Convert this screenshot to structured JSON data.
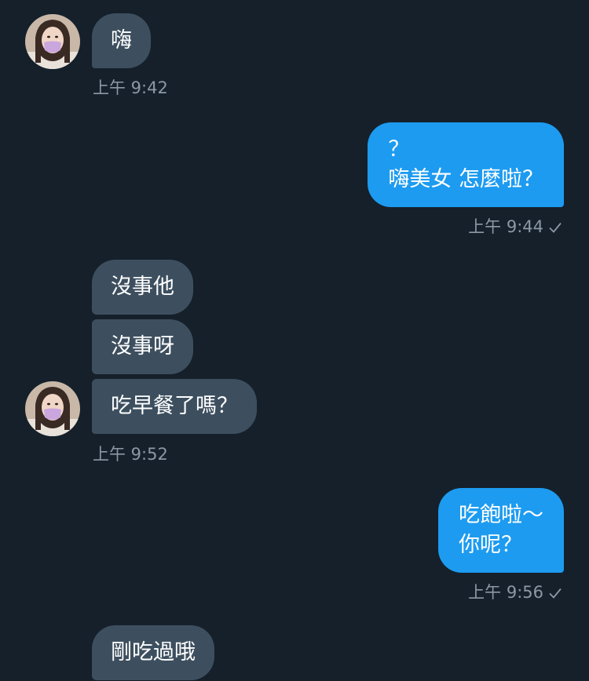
{
  "conversation": {
    "messages": [
      {
        "from": "them",
        "text": "嗨",
        "time": "上午 9:42"
      },
      {
        "from": "me",
        "lines": [
          "？",
          "嗨美女 怎麼啦？"
        ],
        "time": "上午 9:44"
      },
      {
        "from": "them",
        "text": "沒事他"
      },
      {
        "from": "them",
        "text": "沒事呀"
      },
      {
        "from": "them",
        "text": "吃早餐了嗎？",
        "time": "上午 9:52"
      },
      {
        "from": "me",
        "lines": [
          "吃飽啦～",
          "你呢？"
        ],
        "time": "上午 9:56"
      },
      {
        "from": "them",
        "text": "剛吃過哦"
      }
    ]
  },
  "icons": {
    "sent": "checkmark-icon",
    "avatar": "contact-avatar"
  },
  "colors": {
    "background": "#15202b",
    "incoming_bubble": "#3d4f5f",
    "outgoing_bubble": "#1d9bf0",
    "timestamp": "#8b98a5"
  }
}
